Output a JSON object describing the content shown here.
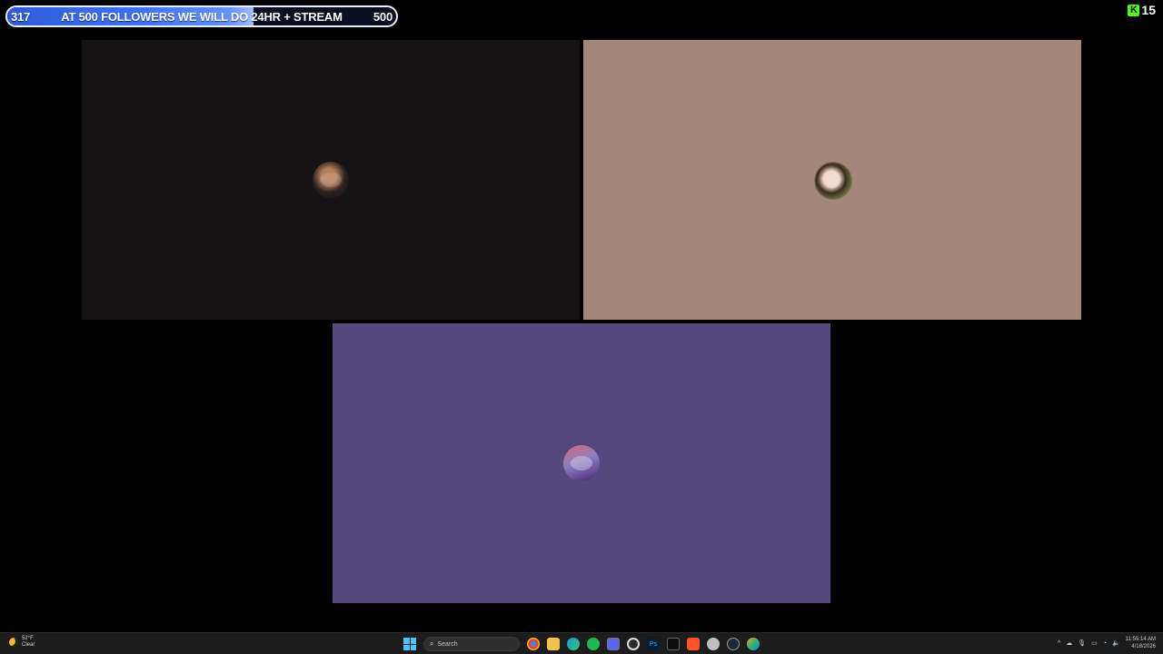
{
  "overlay": {
    "goal_current": "317",
    "goal_title": "AT 500 FOLLOWERS WE WILL DO 24HR + STREAM",
    "goal_target": "500",
    "goal_progress_fraction": 0.634,
    "kick_logo": "K",
    "kick_count": "15"
  },
  "colors": {
    "tile_1": "#161314",
    "tile_2": "#a38879",
    "tile_3": "#54497c",
    "goal_fill": "#3e72f2",
    "kick_green": "#53fc18"
  },
  "tiles": [
    {
      "avatar_icon": "user-avatar-icon"
    },
    {
      "avatar_icon": "user-avatar-icon"
    },
    {
      "avatar_icon": "user-avatar-icon"
    }
  ],
  "taskbar": {
    "weather_temp": "52°F",
    "weather_desc": "Clear",
    "search_placeholder": "Search",
    "apps": [
      "chrome-icon",
      "file-explorer-icon",
      "edge-icon",
      "spotify-icon",
      "discord-icon",
      "obs-icon",
      "photoshop-icon",
      "terminal-icon",
      "brave-icon",
      "app-icon",
      "steam-icon",
      "browser-icon"
    ],
    "photoshop_label": "Ps",
    "time": "11:55:14 AM",
    "date": "4/18/2026"
  }
}
